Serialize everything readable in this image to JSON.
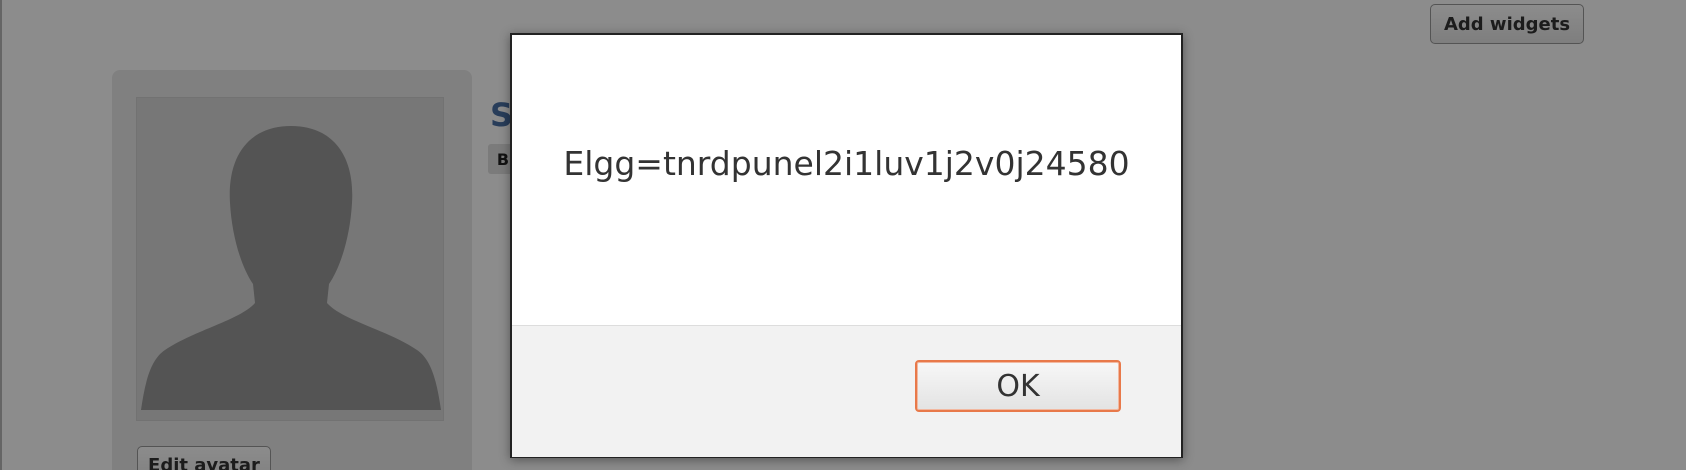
{
  "toolbar": {
    "add_widgets_label": "Add widgets"
  },
  "profile": {
    "name_initial": "S",
    "badge_text": "B",
    "edit_avatar_label": "Edit avatar"
  },
  "alert": {
    "message": "Elgg=tnrdpunel2i1luv1j2v0j24580",
    "ok_label": "OK"
  },
  "colors": {
    "overlay": "#000000",
    "ok_border": "#e8794a",
    "profile_name": "#4a6fa5"
  }
}
